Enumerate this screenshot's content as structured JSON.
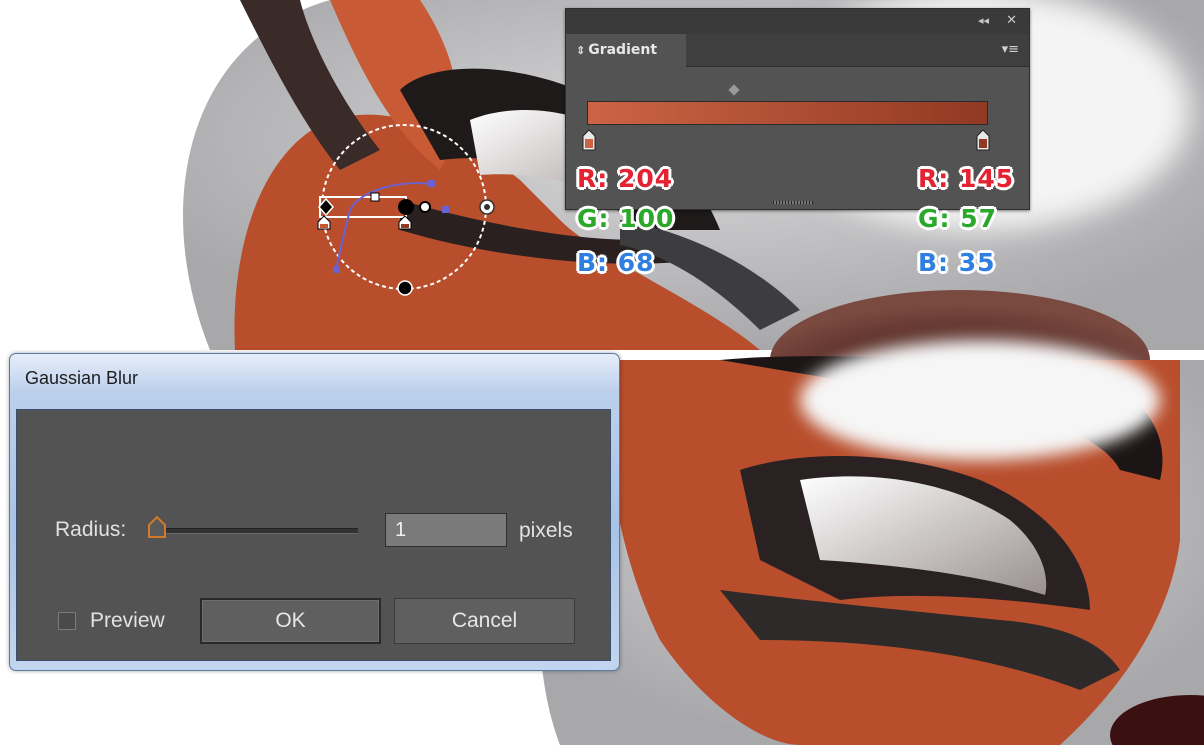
{
  "gradient_panel": {
    "tab_label": "Gradient",
    "tab_arrows": "⇕",
    "collapse_glyph": "◂◂",
    "close_glyph": "✕",
    "menu_glyph": "▾≡",
    "gradient_start_color": "#cc6444",
    "gradient_end_color": "#913923",
    "left_stop": {
      "r": "R: 204",
      "g": "G: 100",
      "b": "B: 68"
    },
    "right_stop": {
      "r": "R: 145",
      "g": "G: 57",
      "b": "B: 35"
    }
  },
  "gaussian_blur": {
    "title": "Gaussian Blur",
    "radius_label": "Radius:",
    "radius_value": "1",
    "units": "pixels",
    "preview_label": "Preview",
    "preview_checked": false,
    "ok_label": "OK",
    "cancel_label": "Cancel"
  },
  "colors": {
    "accent_orange": "#c8562f",
    "panel_dark": "#535353",
    "label_red": "#e32232",
    "label_green": "#2aa82a",
    "label_blue": "#2f7fe0"
  }
}
